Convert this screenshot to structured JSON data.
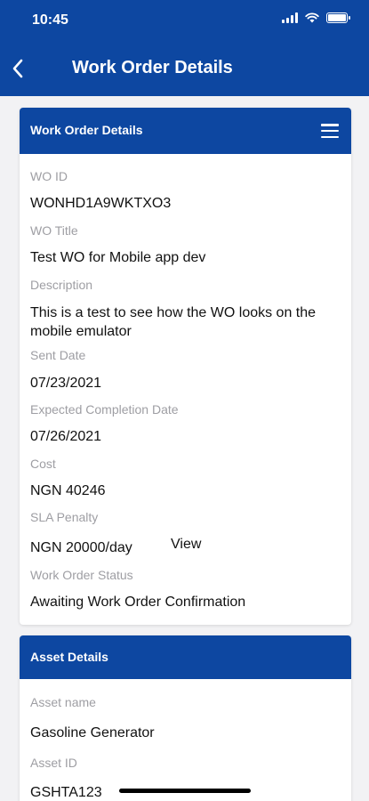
{
  "status": {
    "time": "10:45"
  },
  "header": {
    "title": "Work Order Details"
  },
  "work_order_card": {
    "title": "Work Order Details",
    "fields": [
      {
        "label": "WO ID",
        "value": "WONHD1A9WKTXO3"
      },
      {
        "label": "WO Title",
        "value": "Test WO for Mobile app dev"
      },
      {
        "label": "Description",
        "value": "This is a test to see how the WO looks on the mobile emulator"
      },
      {
        "label": "Sent Date",
        "value": "07/23/2021"
      },
      {
        "label": "Expected Completion Date",
        "value": "07/26/2021"
      },
      {
        "label": "Cost",
        "value": "NGN 40246"
      },
      {
        "label": "SLA Penalty",
        "value": "NGN 20000/day",
        "link": "View"
      },
      {
        "label": "Work Order Status",
        "value": "Awaiting Work Order Confirmation"
      }
    ]
  },
  "asset_card": {
    "title": "Asset Details",
    "fields": [
      {
        "label": "Asset name",
        "value": "Gasoline Generator"
      },
      {
        "label": "Asset ID",
        "value": "GSHTA123"
      }
    ]
  },
  "colors": {
    "primary": "#0d47a1",
    "label": "#9e9ea3",
    "background": "#f2f2f4"
  },
  "icons": {
    "back": "chevron-left-icon",
    "menu": "hamburger-menu-icon"
  }
}
